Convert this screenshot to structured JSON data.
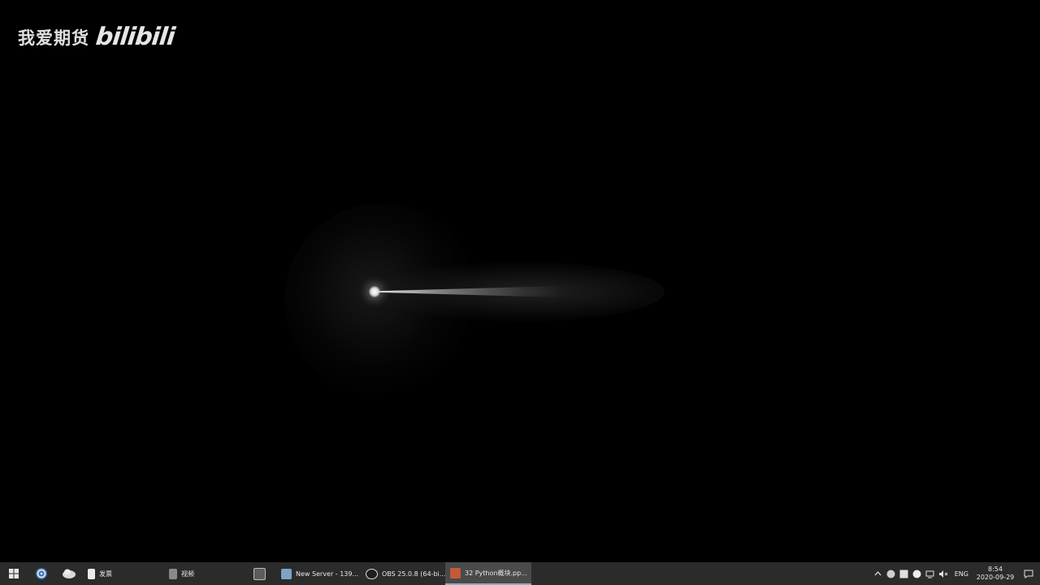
{
  "watermark": {
    "text": "我爱期货",
    "logo": "bilibili"
  },
  "taskbar": {
    "start_icon": "windows-start-icon",
    "pinned": [
      {
        "name": "browser-icon"
      },
      {
        "name": "cloud-app-icon"
      }
    ],
    "apps": [
      {
        "label": "发票",
        "icon": "document-icon"
      },
      {
        "label": "视频",
        "icon": "notebook-icon"
      },
      {
        "label": "",
        "icon": "terminal-icon"
      },
      {
        "label": "New Server - 139...",
        "icon": "server-icon"
      },
      {
        "label": "OBS 25.0.8 (64-bi...",
        "icon": "obs-icon"
      },
      {
        "label": "32 Python概块.pp...",
        "icon": "powerpoint-icon",
        "active": true
      }
    ],
    "tray": {
      "language": "ENG",
      "time": "8:54",
      "date": "2020-09-29"
    }
  },
  "colors": {
    "background": "#000000",
    "taskbar": "#2b2b2b",
    "active_app": "#4a4a4a"
  }
}
